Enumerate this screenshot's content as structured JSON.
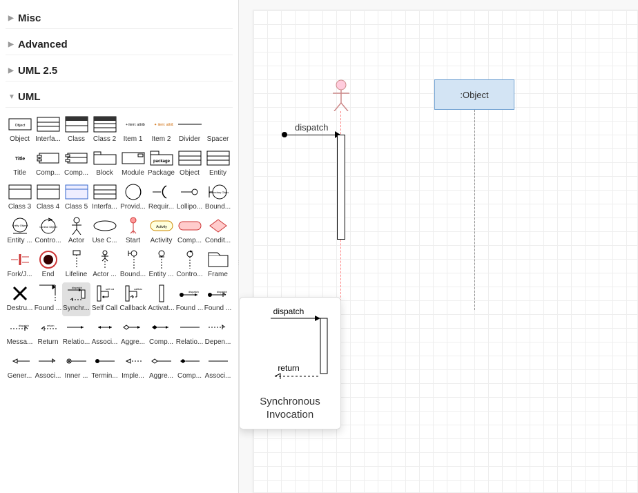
{
  "sections": {
    "misc": "Misc",
    "advanced": "Advanced",
    "uml25": "UML 2.5",
    "uml": "UML"
  },
  "shapes": [
    "Object",
    "Interfa...",
    "Class",
    "Class 2",
    "Item 1",
    "Item 2",
    "Divider",
    "Spacer",
    "Title",
    "Comp...",
    "Comp...",
    "Block",
    "Module",
    "Package",
    "Object",
    "Entity",
    "Class 3",
    "Class 4",
    "Class 5",
    "Interfa...",
    "Provid...",
    "Requir...",
    "Lollipo...",
    "Bound...",
    "Entity ...",
    "Contro...",
    "Actor",
    "Use C...",
    "Start",
    "Activity",
    "Comp...",
    "Condit...",
    "Fork/J...",
    "End",
    "Lifeline",
    "Actor ...",
    "Bound...",
    "Entity ...",
    "Contro...",
    "Frame",
    "Destru...",
    "Found ...",
    "Synchr...",
    "Self Call",
    "Callback",
    "Activat...",
    "Found ...",
    "Found ...",
    "Messa...",
    "Return",
    "Relatio...",
    "Associ...",
    "Aggre...",
    "Comp...",
    "Relatio...",
    "Depen...",
    "Gener...",
    "Associ...",
    "Inner ...",
    "Termin...",
    "Imple...",
    "Aggre...",
    "Comp...",
    "Associ..."
  ],
  "selected_shape_index": 42,
  "canvas": {
    "object_label": ":Object",
    "dispatch_label": "dispatch"
  },
  "tooltip": {
    "title": "Synchronous Invocation",
    "dispatch": "dispatch",
    "return": "return"
  },
  "thumb_text": {
    "object_box": "Object",
    "title": "Title",
    "package": "package",
    "boundary": "Boundary Object",
    "entity": "Entity Object",
    "control": "Control Object",
    "activity": "Activity",
    "dispatch": "dispatch",
    "selfcall": "self call",
    "callback": "callback",
    "return": "return"
  }
}
